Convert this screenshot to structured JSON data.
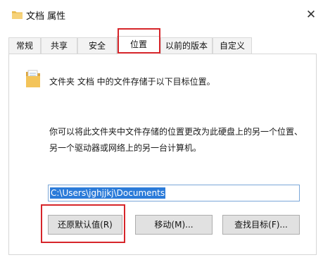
{
  "window": {
    "title": "文档 属性",
    "close_label": "✕"
  },
  "tabs": [
    {
      "label": "常规",
      "active": false
    },
    {
      "label": "共享",
      "active": false
    },
    {
      "label": "安全",
      "active": false
    },
    {
      "label": "位置",
      "active": true
    },
    {
      "label": "以前的版本",
      "active": false
    },
    {
      "label": "自定义",
      "active": false
    }
  ],
  "location": {
    "summary": "文件夹 文档 中的文件存储于以下目标位置。",
    "description": "你可以将此文件夹中文件存储的位置更改为此硬盘上的另一个位置、另一个驱动器或网络上的另一台计算机。",
    "path": "C:\\Users\\jghjjkj\\Documents"
  },
  "buttons": {
    "restore_default": "还原默认值(R)",
    "move": "移动(M)...",
    "find_target": "查找目标(F)..."
  },
  "colors": {
    "highlight": "#d6252a",
    "selection": "#2b7bd9"
  }
}
